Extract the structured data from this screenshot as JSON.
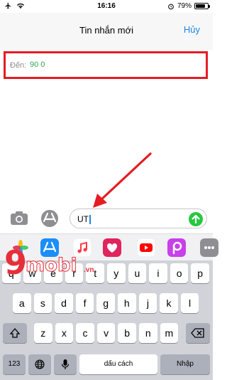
{
  "status_bar": {
    "time": "16:16",
    "battery_text": "79%",
    "battery_level": 0.79,
    "icons": [
      "airplane-icon",
      "wifi-icon",
      "alarm-icon",
      "battery-icon"
    ]
  },
  "nav": {
    "title": "Tin nhắn mới",
    "cancel_label": "Hủy"
  },
  "to_field": {
    "label": "Đến:",
    "value": "90 0",
    "highlight_color": "#e51c23"
  },
  "compose": {
    "text": "UT",
    "send_color": "#28c840"
  },
  "apps": [
    "app-store-icon",
    "music-icon",
    "heart-photo-icon",
    "youtube-icon",
    "picsart-icon",
    "more-apps-icon"
  ],
  "keyboard": {
    "row1": [
      "q",
      "w",
      "e",
      "r",
      "t",
      "y",
      "u",
      "i",
      "o",
      "p"
    ],
    "row2": [
      "a",
      "s",
      "d",
      "f",
      "g",
      "h",
      "j",
      "k",
      "l"
    ],
    "row3": [
      "z",
      "x",
      "c",
      "v",
      "b",
      "n",
      "m"
    ],
    "numbers_label": "123",
    "space_label": "dấu cách",
    "return_label": "Nhập"
  },
  "watermark": {
    "nine": "9",
    "mobi": "mobi",
    "vn": ".vn"
  },
  "colors": {
    "accent": "#1e88e5",
    "annotation": "#e51c23"
  }
}
